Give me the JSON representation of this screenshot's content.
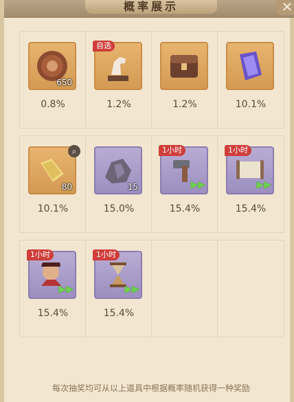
{
  "window": {
    "title": "概率展示",
    "close_label": "✕"
  },
  "rows": [
    {
      "items": [
        {
          "name": "coin",
          "count": "650",
          "rate": "0.8%",
          "rarity": "orange",
          "icon": "coin-icon"
        },
        {
          "name": "horse",
          "tag": "自选",
          "rate": "1.2%",
          "rarity": "orange",
          "icon": "horse-statue-icon"
        },
        {
          "name": "chest",
          "rate": "1.2%",
          "rarity": "orange",
          "icon": "chest-icon"
        },
        {
          "name": "crystal",
          "rate": "10.1%",
          "rarity": "orange",
          "icon": "crystal-icon"
        }
      ]
    },
    {
      "items": [
        {
          "name": "gold-bar",
          "count": "80",
          "rate": "10.1%",
          "rarity": "orange",
          "icon": "gold-bar-icon",
          "magnify": true
        },
        {
          "name": "stone",
          "count": "15",
          "rate": "15.0%",
          "rarity": "purple",
          "icon": "stone-icon"
        },
        {
          "name": "hammer",
          "tag": "1小时",
          "rate": "15.4%",
          "rarity": "purple",
          "icon": "hammer-icon",
          "arrow": true
        },
        {
          "name": "scroll",
          "tag": "1小时",
          "rate": "15.4%",
          "rarity": "purple",
          "icon": "scroll-icon",
          "arrow": true
        }
      ]
    },
    {
      "items": [
        {
          "name": "worker",
          "tag": "1小时",
          "rate": "15.4%",
          "rarity": "purple",
          "icon": "worker-icon",
          "arrow": true
        },
        {
          "name": "hourglass",
          "tag": "1小时",
          "rate": "15.4%",
          "rarity": "purple",
          "icon": "hourglass-icon",
          "arrow": true
        }
      ]
    }
  ],
  "footer_text": "每次抽奖均可从以上道具中根据概率随机获得一种奖励"
}
